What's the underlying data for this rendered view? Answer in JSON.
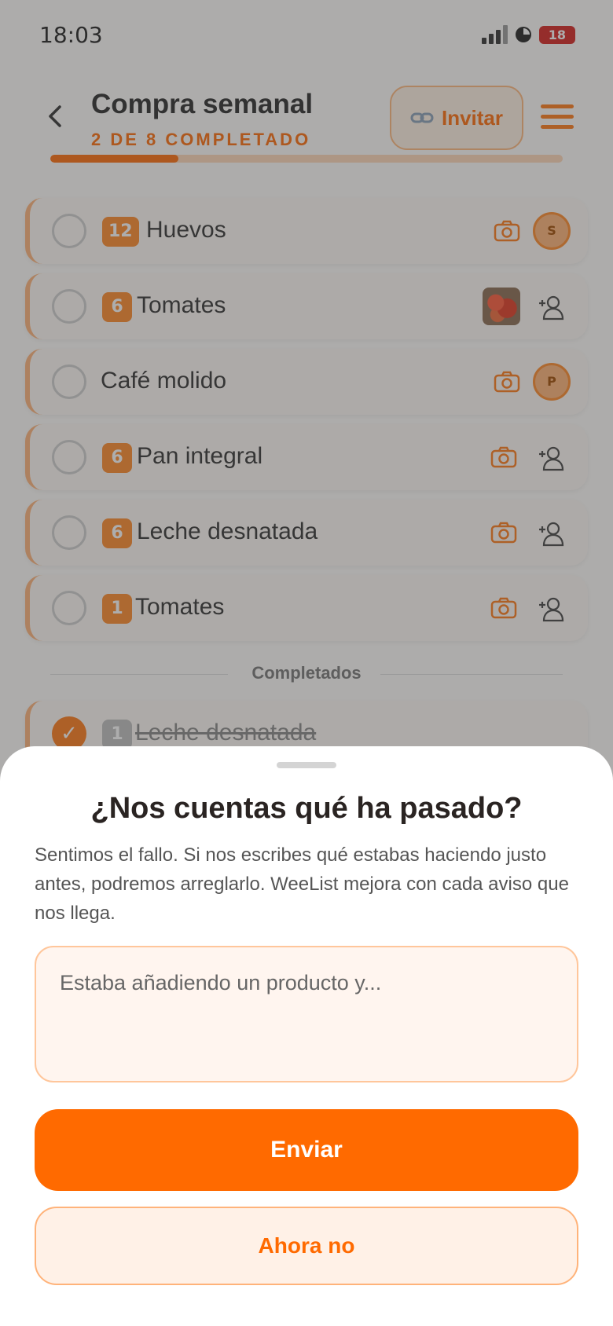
{
  "status_bar": {
    "time": "18:03",
    "battery": "18"
  },
  "header": {
    "title": "Compra semanal",
    "subtitle": "2 DE 8 COMPLETADO",
    "invite_label": "Invitar",
    "progress": 0.25
  },
  "items": [
    {
      "qty": "12",
      "name": "Huevos",
      "avatar": "S"
    },
    {
      "qty": "6",
      "name": "Tomates"
    },
    {
      "qty": "",
      "name": "Café molido",
      "avatar": "P"
    },
    {
      "qty": "6",
      "name": "Pan integral"
    },
    {
      "qty": "6",
      "name": "Leche desnatada"
    },
    {
      "qty": "1",
      "name": "Tomates"
    }
  ],
  "completed_label": "Completados",
  "completed_items": [
    {
      "qty": "1",
      "name": "Leche desnatada"
    }
  ],
  "sheet": {
    "title": "¿Nos cuentas qué ha pasado?",
    "body": "Sentimos el fallo. Si nos escribes qué estabas haciendo justo antes, podremos arreglarlo. WeeList mejora con cada aviso que nos llega.",
    "placeholder": "Estaba añadiendo un producto y...",
    "submit_label": "Enviar",
    "dismiss_label": "Ahora no"
  },
  "colors": {
    "accent": "#ff6a00",
    "accent_light": "#fff1e7"
  }
}
